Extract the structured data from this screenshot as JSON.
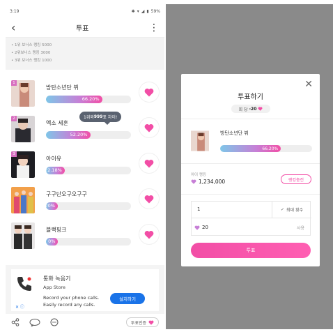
{
  "status": {
    "time": "3:19",
    "battery": "59%"
  },
  "header": {
    "title": "투표"
  },
  "rewards": [
    "• 1위 보너스 랭킹 5000",
    "• 2위보너스 랭킹 3000",
    "• 3위 보너스 랭킹 1000"
  ],
  "rows": [
    {
      "rank": "1",
      "name": "방탄소년단 뷔",
      "pct_label": "66.20%",
      "pct": 66.2
    },
    {
      "rank": "2",
      "name": "엑소 세훈",
      "pct_label": "52.20%",
      "pct": 52.2
    },
    {
      "rank": "3",
      "name": "아이유",
      "pct_label": "22.18%",
      "pct": 22.18
    },
    {
      "rank": "",
      "name": "구구단오구오구구",
      "pct_label": "12.20%",
      "pct": 12.2
    },
    {
      "rank": "",
      "name": "블랙핑크",
      "pct_label": "0%",
      "pct": 0
    }
  ],
  "tooltip": {
    "pre": "1위와 ",
    "num": "999",
    "post": "표 차이!"
  },
  "ad": {
    "title": "통화 녹음기",
    "store": "App Store",
    "desc1": "Record your phone calls.",
    "desc2": "Easily record any calls.",
    "install": "설치하기",
    "x": "✕ ⓘ"
  },
  "bottom": {
    "verify": "투표인증"
  },
  "dialog": {
    "title": "투표하기",
    "cost_prefix": "회 당",
    "cost_value": "-20",
    "idol_name": "방탄소년단 뷔",
    "pct_label": "66.20%",
    "pct": 66.2,
    "idol_rank_label": "아이 랭킹",
    "idol_rank_value": "1,234,000",
    "charge": "랭킹충전",
    "count_value": "1",
    "max_label": "최대 횟수",
    "use_value": "20",
    "use_label": "사용",
    "vote": "투표"
  },
  "colors": {
    "accent": "#f24ea6",
    "bar_start": "#7ec6e8",
    "dim": "#8a8a8a"
  },
  "icons": [
    "back-arrow-icon",
    "more-vert-icon",
    "heart-icon",
    "share-icon",
    "chat-icon",
    "comment-icon",
    "close-icon",
    "check-icon",
    "phone-icon",
    "wifi-icon",
    "signal-icon",
    "battery-icon"
  ]
}
